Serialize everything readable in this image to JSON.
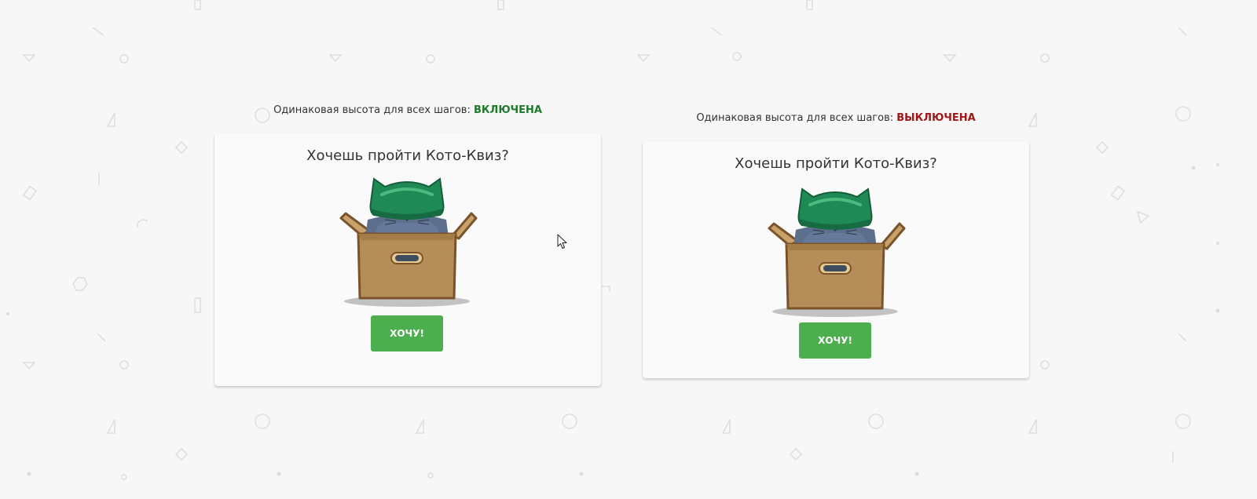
{
  "demos": [
    {
      "caption_label": "Одинаковая высота для всех шагов:",
      "status": "ВКЛЮЧЕНА",
      "question": "Хочешь пройти Кото-Квиз?",
      "button_label": "ХОЧУ!"
    },
    {
      "caption_label": "Одинаковая высота для всех шагов:",
      "status": "ВЫКЛЮЧЕНА",
      "question": "Хочешь пройти Кото-Квиз?",
      "button_label": "ХОЧУ!"
    }
  ],
  "colors": {
    "status_on": "#1d7a2a",
    "status_off": "#a11616",
    "button": "#4cae4f",
    "helmet": "#1f8a55",
    "box": "#b58d58",
    "background": "#f7f7f7"
  },
  "icons": [
    "cat-in-box-illustration",
    "mouse-cursor-icon"
  ]
}
